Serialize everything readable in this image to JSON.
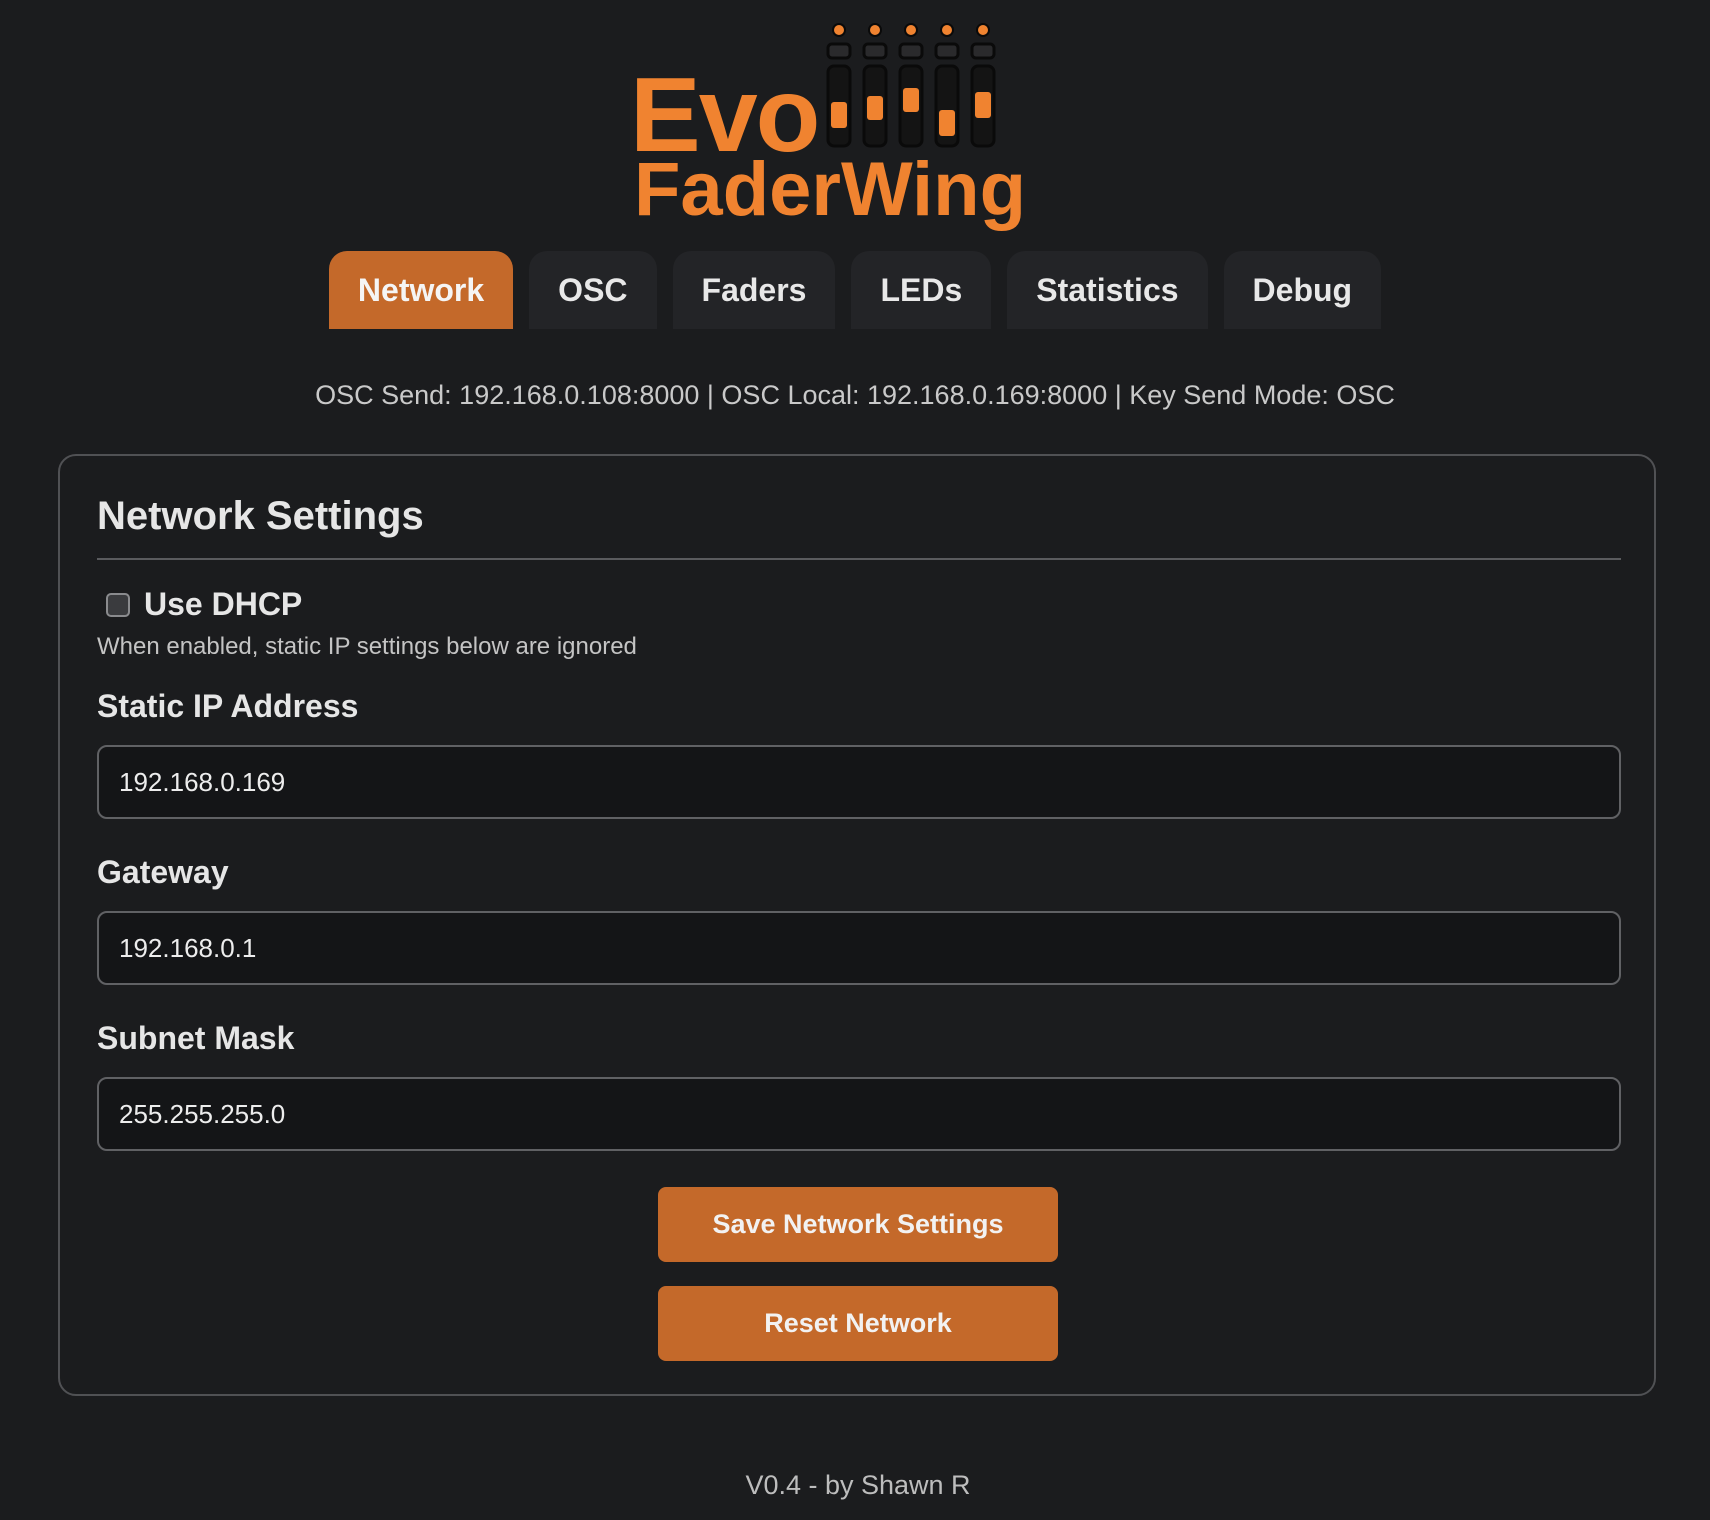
{
  "logo": {
    "line1": "Evo",
    "line2": "FaderWing",
    "icon": "fader-bank-icon",
    "accent_color": "#f08330"
  },
  "tabs": [
    {
      "label": "Network",
      "active": true
    },
    {
      "label": "OSC",
      "active": false
    },
    {
      "label": "Faders",
      "active": false
    },
    {
      "label": "LEDs",
      "active": false
    },
    {
      "label": "Statistics",
      "active": false
    },
    {
      "label": "Debug",
      "active": false
    }
  ],
  "status_line": "OSC Send: 192.168.0.108:8000 | OSC Local: 192.168.0.169:8000 | Key Send Mode: OSC",
  "network_settings": {
    "title": "Network Settings",
    "dhcp": {
      "label": "Use DHCP",
      "checked": false,
      "hint": "When enabled, static IP settings below are ignored"
    },
    "static_ip": {
      "label": "Static IP Address",
      "value": "192.168.0.169"
    },
    "gateway": {
      "label": "Gateway",
      "value": "192.168.0.1"
    },
    "subnet": {
      "label": "Subnet Mask",
      "value": "255.255.255.0"
    },
    "save_label": "Save Network Settings",
    "reset_label": "Reset Network"
  },
  "footer": "V0.4 - by Shawn R",
  "colors": {
    "accent": "#c4692a",
    "background": "#1b1c1e",
    "tab_inactive": "#232427"
  }
}
